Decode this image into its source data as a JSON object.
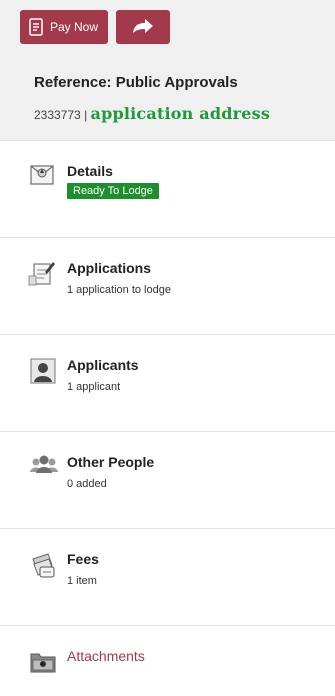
{
  "header": {
    "pay_now_label": "Pay Now",
    "reference_title": "Reference: Public Approvals",
    "reference_id": "2333773",
    "separator": "|",
    "application_address": "application address"
  },
  "items": [
    {
      "title": "Details",
      "badge": "Ready To Lodge",
      "icon": "certificate-icon"
    },
    {
      "title": "Applications",
      "sub": "1 application to lodge",
      "icon": "document-pen-icon"
    },
    {
      "title": "Applicants",
      "sub": "1 applicant",
      "icon": "person-icon"
    },
    {
      "title": "Other People",
      "sub": "0 added",
      "icon": "group-icon"
    },
    {
      "title": "Fees",
      "sub": "1 item",
      "icon": "fees-icon"
    },
    {
      "title": "Attachments",
      "icon": "attachment-box-icon"
    }
  ],
  "colors": {
    "brand": "#a33a4b",
    "badge_green": "#1e8f2d",
    "address_green": "#1f9a3a"
  }
}
